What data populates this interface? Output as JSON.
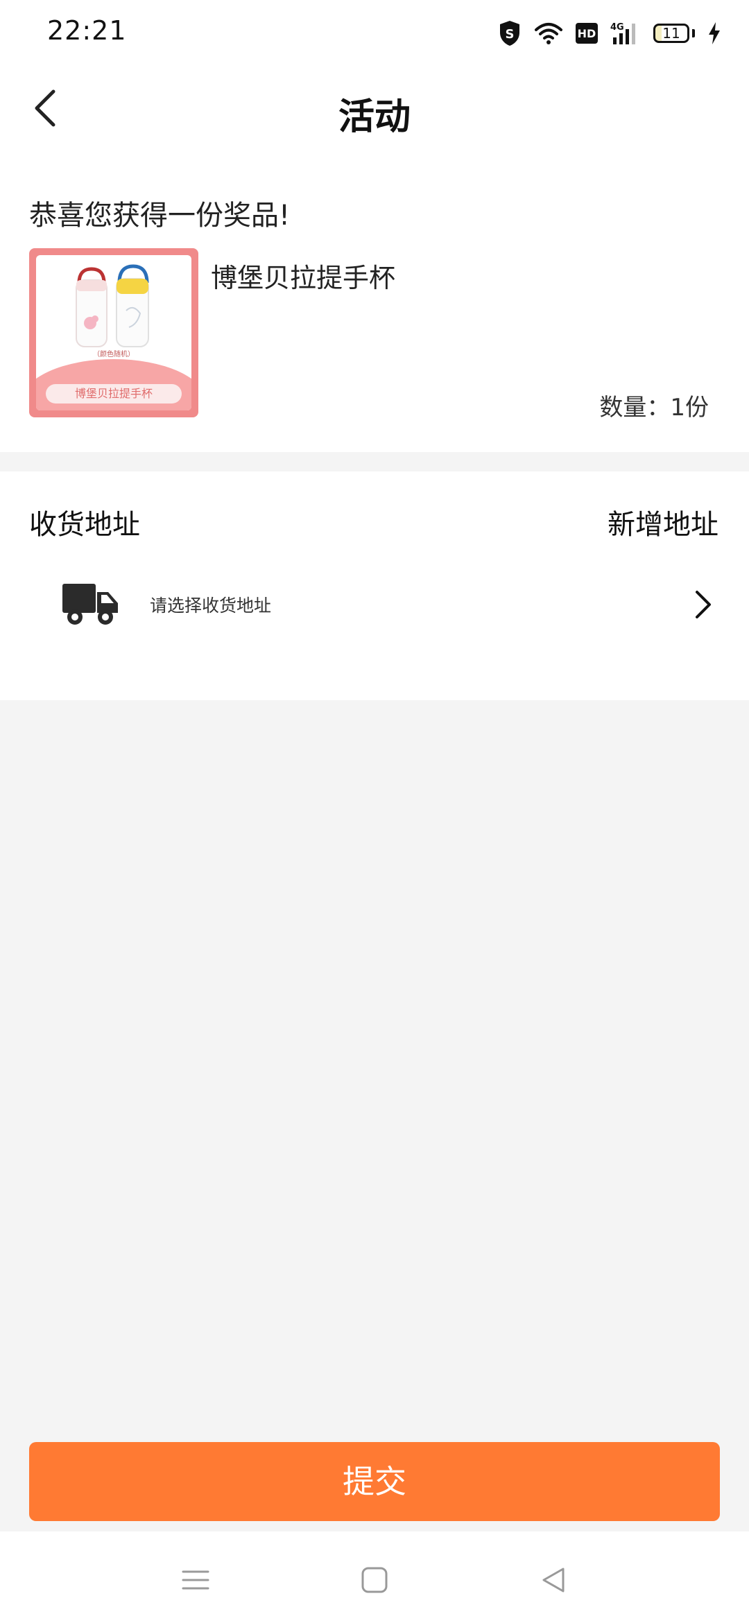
{
  "status_bar": {
    "time": "22:21",
    "network": "4G",
    "battery_level": "11",
    "hd_label": "HD"
  },
  "header": {
    "title": "活动"
  },
  "prize": {
    "heading": "恭喜您获得一份奖品!",
    "name": "博堡贝拉提手杯",
    "quantity": "数量：1份",
    "image_caption": "（颜色随机）",
    "image_banner": "博堡贝拉提手杯"
  },
  "address": {
    "title": "收货地址",
    "add_label": "新增地址",
    "placeholder": "请选择收货地址"
  },
  "actions": {
    "submit_label": "提交"
  },
  "colors": {
    "accent": "#ff7a33",
    "page_bg": "#f4f4f4",
    "prize_frame": "#f08a8a"
  }
}
